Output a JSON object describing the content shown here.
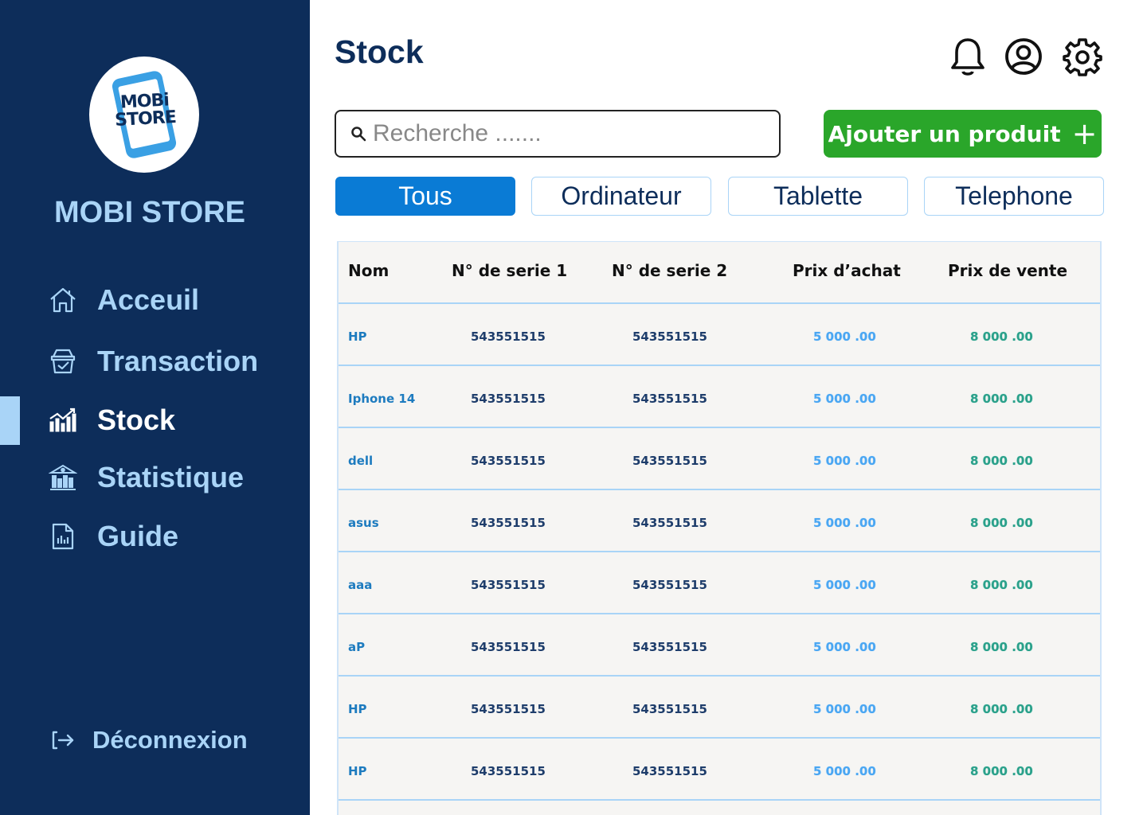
{
  "brand": {
    "logo_line1": "MOBi",
    "logo_line2": "STORE",
    "name": "MOBI STORE"
  },
  "sidebar": {
    "items": [
      {
        "label": "Acceuil",
        "icon": "home-icon"
      },
      {
        "label": "Transaction",
        "icon": "basket-check-icon"
      },
      {
        "label": "Stock",
        "icon": "bar-chart-icon",
        "active": true
      },
      {
        "label": "Statistique",
        "icon": "stats-building-icon"
      },
      {
        "label": "Guide",
        "icon": "document-chart-icon"
      }
    ],
    "logout_label": "Déconnexion"
  },
  "header": {
    "title": "Stock",
    "icons": [
      "bell-icon",
      "user-circle-icon",
      "gear-icon"
    ]
  },
  "search": {
    "placeholder": "Recherche ......."
  },
  "toolbar": {
    "add_label": "Ajouter un produit",
    "add_icon": "+"
  },
  "tabs": [
    {
      "label": "Tous",
      "active": true
    },
    {
      "label": "Ordinateur",
      "active": false
    },
    {
      "label": "Tablette",
      "active": false
    },
    {
      "label": "Telephone",
      "active": false
    }
  ],
  "table": {
    "columns": [
      "Nom",
      "N° de serie 1",
      "N° de serie 2",
      "Prix d’achat",
      "Prix de vente"
    ],
    "rows": [
      {
        "name": "HP",
        "serie1": "543551515",
        "serie2": "543551515",
        "buy": "5 000 .00",
        "sell": "8 000 .00"
      },
      {
        "name": "Iphone 14",
        "serie1": "543551515",
        "serie2": "543551515",
        "buy": "5 000 .00",
        "sell": "8 000 .00"
      },
      {
        "name": "dell",
        "serie1": "543551515",
        "serie2": "543551515",
        "buy": "5 000 .00",
        "sell": "8 000 .00"
      },
      {
        "name": "asus",
        "serie1": "543551515",
        "serie2": "543551515",
        "buy": "5 000 .00",
        "sell": "8 000 .00"
      },
      {
        "name": "aaa",
        "serie1": "543551515",
        "serie2": "543551515",
        "buy": "5 000 .00",
        "sell": "8 000 .00"
      },
      {
        "name": "aP",
        "serie1": "543551515",
        "serie2": "543551515",
        "buy": "5 000 .00",
        "sell": "8 000 .00"
      },
      {
        "name": "HP",
        "serie1": "543551515",
        "serie2": "543551515",
        "buy": "5 000 .00",
        "sell": "8 000 .00"
      },
      {
        "name": "HP",
        "serie1": "543551515",
        "serie2": "543551515",
        "buy": "5 000 .00",
        "sell": "8 000 .00"
      }
    ]
  },
  "colors": {
    "sidebar_bg": "#0d2d5a",
    "accent_light": "#a9d4f7",
    "tab_active": "#0a7bd5",
    "add_button": "#2aa62a"
  }
}
